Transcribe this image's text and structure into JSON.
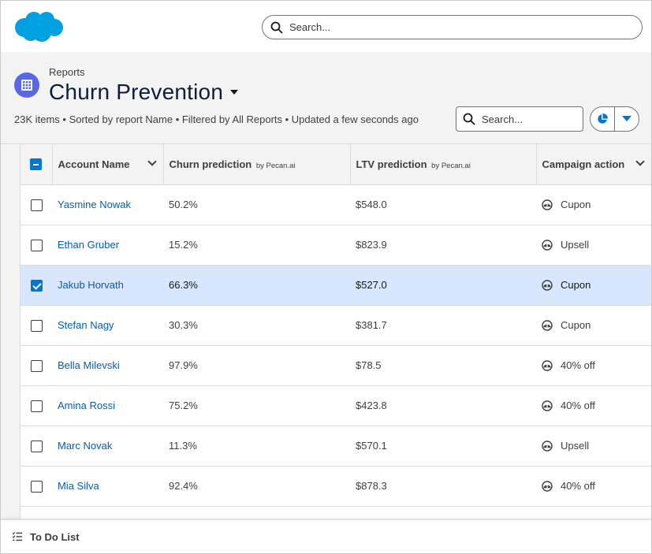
{
  "colors": {
    "brand": "#00a1e0",
    "report_icon_bg": "#5867e8",
    "link": "#0b5cab",
    "selected_row": "#d8e6fe",
    "checkbox_checked": "#0176d3"
  },
  "header": {
    "logo": "salesforce-cloud-logo",
    "search_placeholder": "Search..."
  },
  "page": {
    "object_icon": "report-grid-icon",
    "breadcrumb": "Reports",
    "title": "Churn Prevention",
    "meta": "23K items • Sorted by report Name • Filtered by All Reports • Updated a few seconds ago",
    "list_search_placeholder": "Search...",
    "chart_button_icon": "pie-chart-icon",
    "menu_button_icon": "caret-down-icon"
  },
  "table": {
    "columns": [
      {
        "label": "Account Name",
        "sub": ""
      },
      {
        "label": "Churn prediction",
        "sub": "by Pecan.ai"
      },
      {
        "label": "LTV prediction",
        "sub": "by Pecan.ai"
      },
      {
        "label": "Campaign action",
        "sub": ""
      }
    ],
    "header_checkbox_state": "indeterminate",
    "rows": [
      {
        "name": "Yasmine Nowak",
        "churn": "50.2%",
        "ltv": "$548.0",
        "action": "Cupon",
        "action_icon": "gauge-icon",
        "selected": false
      },
      {
        "name": "Ethan Gruber",
        "churn": "15.2%",
        "ltv": "$823.9",
        "action": "Upsell",
        "action_icon": "gauge-icon",
        "selected": false
      },
      {
        "name": "Jakub Horvath",
        "churn": "66.3%",
        "ltv": "$527.0",
        "action": "Cupon",
        "action_icon": "gauge-icon",
        "selected": true
      },
      {
        "name": "Stefan Nagy",
        "churn": "30.3%",
        "ltv": "$381.7",
        "action": "Cupon",
        "action_icon": "gauge-icon",
        "selected": false
      },
      {
        "name": "Bella Milevski",
        "churn": "97.9%",
        "ltv": "$78.5",
        "action": "40% off",
        "action_icon": "gauge-icon",
        "selected": false
      },
      {
        "name": "Amina Rossi",
        "churn": "75.2%",
        "ltv": "$423.8",
        "action": "40% off",
        "action_icon": "gauge-icon",
        "selected": false
      },
      {
        "name": "Marc Novak",
        "churn": "11.3%",
        "ltv": "$570.1",
        "action": "Upsell",
        "action_icon": "gauge-icon",
        "selected": false
      },
      {
        "name": "Mia Silva",
        "churn": "92.4%",
        "ltv": "$878.3",
        "action": "40% off",
        "action_icon": "gauge-icon",
        "selected": false
      },
      {
        "name": "",
        "churn": "",
        "ltv": "",
        "action": "",
        "action_icon": "",
        "selected": false
      }
    ]
  },
  "footer": {
    "label": "To Do List",
    "icon": "checklist-icon"
  }
}
